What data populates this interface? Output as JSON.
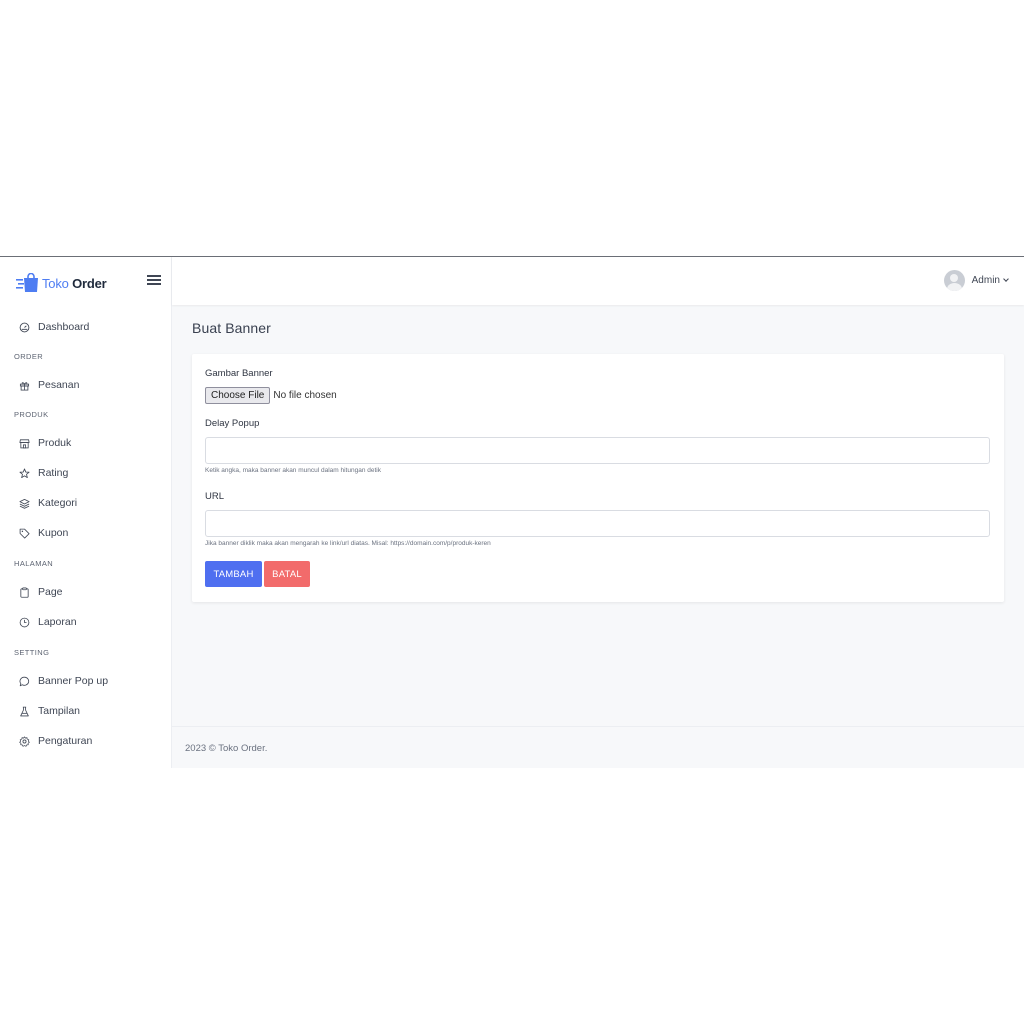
{
  "brand": {
    "name_part1": "Toko",
    "name_part2": "Order",
    "color_primary": "#4e7df2"
  },
  "sidebar": {
    "items": [
      {
        "label": "Dashboard",
        "icon": "dashboard-gauge-icon"
      },
      {
        "section": "ORDER"
      },
      {
        "label": "Pesanan",
        "icon": "gift-icon"
      },
      {
        "section": "PRODUK"
      },
      {
        "label": "Produk",
        "icon": "store-icon"
      },
      {
        "label": "Rating",
        "icon": "star-icon"
      },
      {
        "label": "Kategori",
        "icon": "layers-icon"
      },
      {
        "label": "Kupon",
        "icon": "tag-icon"
      },
      {
        "section": "HALAMAN"
      },
      {
        "label": "Page",
        "icon": "clipboard-icon"
      },
      {
        "label": "Laporan",
        "icon": "clock-icon"
      },
      {
        "section": "SETTING"
      },
      {
        "label": "Banner Pop up",
        "icon": "chat-bubble-icon"
      },
      {
        "label": "Tampilan",
        "icon": "flask-icon"
      },
      {
        "label": "Pengaturan",
        "icon": "gear-icon"
      }
    ]
  },
  "header": {
    "user_name": "Admin"
  },
  "main": {
    "title": "Buat Banner",
    "form": {
      "gambar_label": "Gambar Banner",
      "file_button": "Choose File",
      "file_status": "No file chosen",
      "delay_label": "Delay Popup",
      "delay_value": "",
      "delay_help": "Ketik angka, maka banner akan muncul dalam hitungan detik",
      "url_label": "URL",
      "url_value": "",
      "url_help": "Jika banner diklik maka akan mengarah ke link/url diatas. Misal: https://domain.com/p/produk-keren",
      "submit_label": "TAMBAH",
      "cancel_label": "BATAL"
    }
  },
  "footer": {
    "text": "2023 © Toko Order."
  },
  "colors": {
    "primary_button": "#4f6ff0",
    "danger_button": "#f26b6b",
    "background": "#f7f8fa"
  }
}
